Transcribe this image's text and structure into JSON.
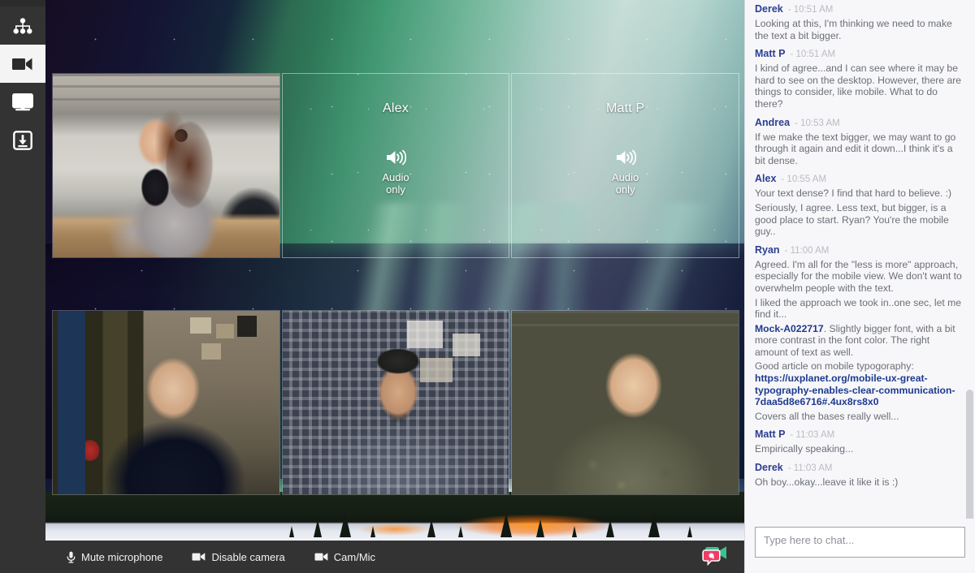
{
  "app": {
    "accent_green": "#3fbf8f",
    "accent_pink": "#ef3d65",
    "sidebar_bg": "#333333",
    "chat_bg": "#f7f7f9",
    "author_color": "#2c3e92",
    "link_color": "#1e3a8f",
    "message_color": "#6b6f78",
    "timestamp_color": "#b9bcc4"
  },
  "sidebar": {
    "items": [
      {
        "id": "org-chart",
        "icon": "org-chart-icon",
        "label": "Team",
        "active": false
      },
      {
        "id": "video",
        "icon": "video-camera-icon",
        "label": "Video",
        "active": true
      },
      {
        "id": "screen",
        "icon": "monitor-icon",
        "label": "Screen share",
        "active": false
      },
      {
        "id": "download",
        "icon": "download-icon",
        "label": "Save",
        "active": false
      }
    ]
  },
  "stage": {
    "participants": [
      {
        "id": "p1",
        "name": "",
        "kind": "video",
        "label": ""
      },
      {
        "id": "p2",
        "name": "Alex",
        "kind": "audio",
        "label": "Audio\nonly",
        "audio_line1": "Audio",
        "audio_line2": "only"
      },
      {
        "id": "p3",
        "name": "Matt P",
        "kind": "audio",
        "label": "Audio\nonly",
        "audio_line1": "Audio",
        "audio_line2": "only"
      },
      {
        "id": "p4",
        "name": "",
        "kind": "video",
        "label": ""
      },
      {
        "id": "p5",
        "name": "",
        "kind": "video",
        "label": ""
      },
      {
        "id": "p6",
        "name": "",
        "kind": "video",
        "label": ""
      }
    ]
  },
  "toolbar": {
    "buttons": [
      {
        "id": "mute-microphone",
        "icon": "microphone-icon",
        "label": "Mute microphone"
      },
      {
        "id": "disable-camera",
        "icon": "video-camera-icon",
        "label": "Disable camera"
      },
      {
        "id": "cam-mic",
        "icon": "video-camera-icon",
        "label": "Cam/Mic"
      }
    ],
    "chat_toggle_icon": "video-chat-icon"
  },
  "chat": {
    "messages": [
      {
        "author": "Derek",
        "time": "- 10:51 AM",
        "lines": [
          {
            "text": "Looking at this, I'm thinking we need to make the text a bit bigger."
          }
        ]
      },
      {
        "author": "Matt P",
        "time": "- 10:51 AM",
        "lines": [
          {
            "text": "I kind of agree...and I can see where it may be hard to see on the desktop. However, there are things to consider, like mobile. What to do there?"
          }
        ]
      },
      {
        "author": "Andrea",
        "time": "- 10:53 AM",
        "lines": [
          {
            "text": "If we make the text bigger, we may want to go through it again and edit it down...I think it's a bit dense."
          }
        ]
      },
      {
        "author": "Alex",
        "time": "- 10:55 AM",
        "lines": [
          {
            "text": "Your text dense? I find that hard to believe. :)"
          },
          {
            "text": "Seriously, I agree. Less text, but bigger, is a good place to start. Ryan? You're the mobile guy.."
          }
        ]
      },
      {
        "author": "Ryan",
        "time": "- 11:00 AM",
        "lines": [
          {
            "text": "Agreed. I'm all for the \"less is more\" approach, especially for the mobile view. We don't want to overwhelm people with the text."
          },
          {
            "text": "I liked the approach we took in..one sec, let me find it..."
          },
          {
            "link": "Mock-A022717",
            "text": ". Slightly bigger font, with a bit more contrast in the font color. The right amount of text as well."
          },
          {
            "text": "Good article on mobile typogoraphy: ",
            "link_after": "https://uxplanet.org/mobile-ux-great-typography-enables-clear-communication-7daa5d8e6716#.4ux8rs8x0"
          },
          {
            "text": "Covers all the bases really well..."
          }
        ]
      },
      {
        "author": "Matt P",
        "time": "- 11:03 AM",
        "lines": [
          {
            "text": "Empirically speaking..."
          }
        ]
      },
      {
        "author": "Derek",
        "time": "- 11:03 AM",
        "lines": [
          {
            "text": "Oh boy...okay...leave it like it is :)"
          }
        ]
      }
    ],
    "input_placeholder": "Type here to chat...",
    "input_value": ""
  }
}
